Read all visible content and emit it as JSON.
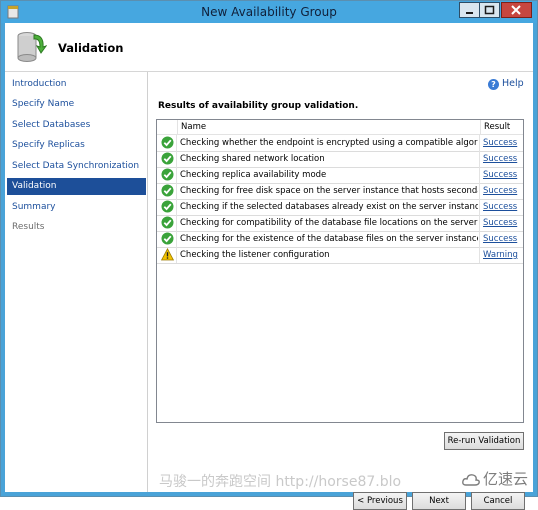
{
  "window": {
    "title": "New Availability Group"
  },
  "header": {
    "title": "Validation"
  },
  "sidebar": {
    "items": [
      {
        "label": "Introduction",
        "state": "link"
      },
      {
        "label": "Specify Name",
        "state": "link"
      },
      {
        "label": "Select Databases",
        "state": "link"
      },
      {
        "label": "Specify Replicas",
        "state": "link"
      },
      {
        "label": "Select Data Synchronization",
        "state": "link"
      },
      {
        "label": "Validation",
        "state": "active"
      },
      {
        "label": "Summary",
        "state": "link"
      },
      {
        "label": "Results",
        "state": "disabled"
      }
    ]
  },
  "main": {
    "help_label": "Help",
    "section_title": "Results of availability group validation.",
    "columns": {
      "name": "Name",
      "result": "Result"
    },
    "rows": [
      {
        "icon": "success-check-icon",
        "name": "Checking whether the endpoint is encrypted using a compatible algorithm",
        "result": "Success"
      },
      {
        "icon": "success-check-icon",
        "name": "Checking shared network location",
        "result": "Success"
      },
      {
        "icon": "success-check-icon",
        "name": "Checking replica availability mode",
        "result": "Success"
      },
      {
        "icon": "success-check-icon",
        "name": "Checking for free disk space on the server instance that hosts secondary re...",
        "result": "Success"
      },
      {
        "icon": "success-check-icon",
        "name": "Checking if the selected databases already exist on the server instance that ...",
        "result": "Success"
      },
      {
        "icon": "success-check-icon",
        "name": "Checking for compatibility of the database file locations on the server insta...",
        "result": "Success"
      },
      {
        "icon": "success-check-icon",
        "name": "Checking for the existence of the database files on the server instance that ...",
        "result": "Success"
      },
      {
        "icon": "warning-triangle-icon",
        "name": "Checking the listener configuration",
        "result": "Warning"
      }
    ],
    "rerun_label": "Re-run Validation"
  },
  "footer": {
    "previous_label": "< Previous",
    "next_label": "Next",
    "cancel_label": "Cancel"
  },
  "watermark": {
    "text": "马骏一的奔跑空间 http://horse87.blo",
    "brand": "亿速云"
  },
  "colors": {
    "title_bar": "#46a7e0",
    "nav_active": "#1d4f99",
    "link": "#1c4f9c",
    "success": "#3aa33a",
    "warning": "#f2c200"
  }
}
